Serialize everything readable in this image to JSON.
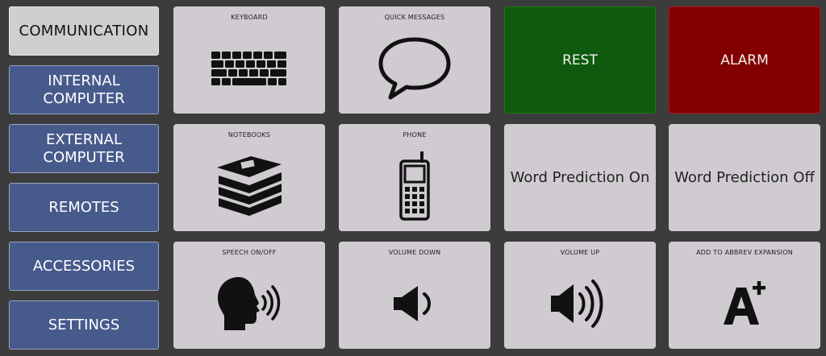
{
  "sidebar": {
    "items": [
      {
        "label": "COMMUNICATION"
      },
      {
        "label": "INTERNAL COMPUTER"
      },
      {
        "label": "EXTERNAL COMPUTER"
      },
      {
        "label": "REMOTES"
      },
      {
        "label": "ACCESSORIES"
      },
      {
        "label": "SETTINGS"
      }
    ]
  },
  "tiles": {
    "keyboard": {
      "label": "KEYBOARD",
      "icon": "keyboard-icon"
    },
    "quick_messages": {
      "label": "QUICK MESSAGES",
      "icon": "speech-bubble-icon"
    },
    "rest": {
      "label": "REST",
      "color": "#0e5a0e"
    },
    "alarm": {
      "label": "ALARM",
      "color": "#820000"
    },
    "notebooks": {
      "label": "NOTEBOOKS",
      "icon": "notebooks-icon"
    },
    "phone": {
      "label": "PHONE",
      "icon": "phone-icon"
    },
    "word_prediction_on": {
      "label": "Word Prediction On"
    },
    "word_prediction_off": {
      "label": "Word Prediction Off"
    },
    "speech": {
      "label": "SPEECH ON/OFF",
      "icon": "speaking-head-icon"
    },
    "volume_down": {
      "label": "VOLUME DOWN",
      "icon": "volume-down-icon"
    },
    "volume_up": {
      "label": "VOLUME UP",
      "icon": "volume-up-icon"
    },
    "abbrev": {
      "label": "ADD TO ABBREV EXPANSION",
      "icon": "a-plus-icon"
    }
  },
  "colors": {
    "background": "#3c3c3c",
    "sidebar_button": "#475a8c",
    "active_button": "#cfcfcf",
    "tile": "#cfcbd0"
  }
}
